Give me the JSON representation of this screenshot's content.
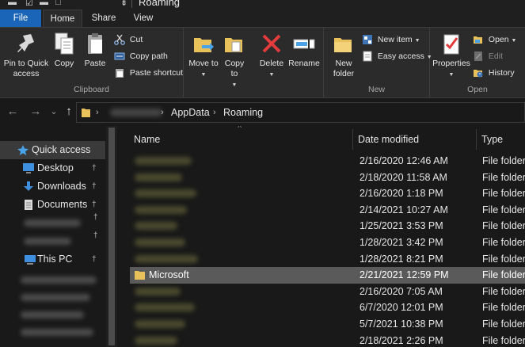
{
  "window": {
    "title": "Roaming"
  },
  "ribbon_tabs": [
    {
      "label": "File"
    },
    {
      "label": "Home"
    },
    {
      "label": "Share"
    },
    {
      "label": "View"
    }
  ],
  "ribbon": {
    "clipboard": {
      "label": "Clipboard",
      "pin_to_quick_access": "Pin to Quick access",
      "copy": "Copy",
      "paste": "Paste",
      "cut": "Cut",
      "copy_path": "Copy path",
      "paste_shortcut": "Paste shortcut"
    },
    "organize": {
      "move_to": "Move to",
      "copy_to": "Copy to",
      "delete": "Delete",
      "rename": "Rename"
    },
    "new": {
      "label": "New",
      "new_folder": "New folder",
      "new_item": "New item",
      "easy_access": "Easy access"
    },
    "open": {
      "label": "Open",
      "properties": "Properties",
      "open": "Open",
      "edit": "Edit",
      "history": "History"
    }
  },
  "address": {
    "breadcrumbs": [
      "AppData",
      "Roaming"
    ],
    "separator": ">"
  },
  "nav_glyphs": {
    "back": "←",
    "forward": "→",
    "recent": "⌄",
    "up": "↑",
    "crumb_arrow": "›",
    "pin": "†",
    "sort": "˄"
  },
  "nav_pane": {
    "items": [
      {
        "label": "Quick access",
        "icon": "star-icon",
        "selected": true
      },
      {
        "label": "Desktop",
        "icon": "desktop-icon",
        "pinned": true
      },
      {
        "label": "Downloads",
        "icon": "download-icon",
        "pinned": true
      },
      {
        "label": "Documents",
        "icon": "documents-icon",
        "pinned": true
      },
      {
        "label": "This PC",
        "icon": "computer-icon",
        "pinned": true
      }
    ]
  },
  "columns": {
    "name": "Name",
    "date_modified": "Date modified",
    "type": "Type"
  },
  "files": [
    {
      "name": "",
      "date": "2/16/2020 12:46 AM",
      "type": "File folder"
    },
    {
      "name": "",
      "date": "2/18/2020 11:58 AM",
      "type": "File folder"
    },
    {
      "name": "",
      "date": "2/16/2020 1:18 PM",
      "type": "File folder"
    },
    {
      "name": "",
      "date": "2/14/2021 10:27 AM",
      "type": "File folder"
    },
    {
      "name": "",
      "date": "1/25/2021 3:53 PM",
      "type": "File folder"
    },
    {
      "name": "",
      "date": "1/28/2021 3:42 PM",
      "type": "File folder"
    },
    {
      "name": "",
      "date": "1/28/2021 8:21 PM",
      "type": "File folder"
    },
    {
      "name": "Microsoft",
      "date": "2/21/2021 12:59 PM",
      "type": "File folder",
      "selected": true
    },
    {
      "name": "",
      "date": "2/16/2020 7:05 AM",
      "type": "File folder"
    },
    {
      "name": "",
      "date": "6/7/2020 12:01 PM",
      "type": "File folder"
    },
    {
      "name": "",
      "date": "5/7/2021 10:38 PM",
      "type": "File folder"
    },
    {
      "name": "",
      "date": "2/18/2021 2:26 PM",
      "type": "File folder"
    }
  ],
  "colors": {
    "file_tab": "#1a65b8",
    "folder": "#e8c15b",
    "delete_x": "#e23b3b",
    "selection": "#5a5a5a",
    "background": "#191919",
    "ribbon": "#2b2b2b"
  }
}
